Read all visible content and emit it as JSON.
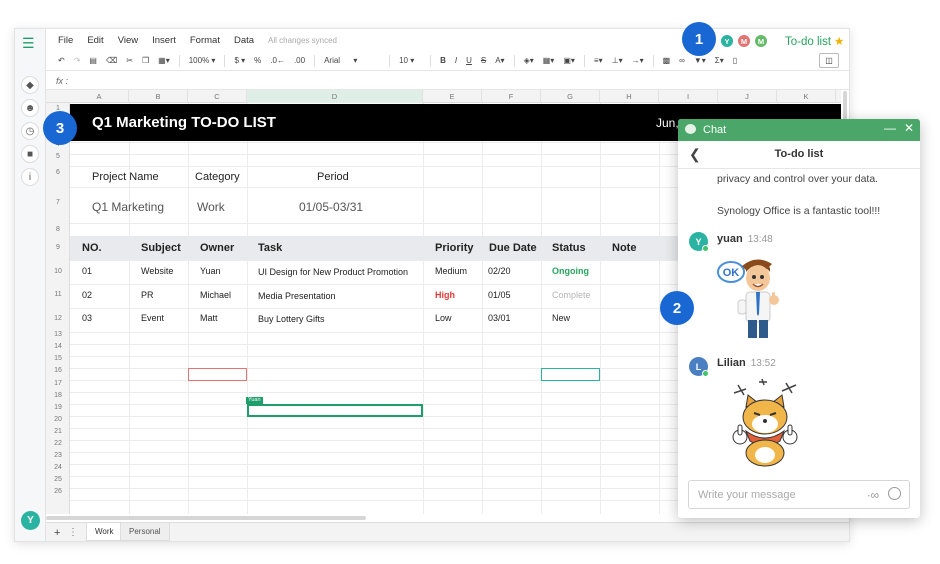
{
  "menu": [
    "File",
    "Edit",
    "View",
    "Insert",
    "Format",
    "Data"
  ],
  "sync_status": "All changes synced",
  "collaborators": [
    {
      "initial": "Y",
      "color": "#2bb3a1"
    },
    {
      "initial": "M",
      "color": "#e57373"
    },
    {
      "initial": "M",
      "color": "#66bb6a"
    }
  ],
  "doc_title": "To-do list",
  "toolbar": {
    "zoom": "100%",
    "currency": "$",
    "percent": "%",
    "font": "Arial",
    "size": "10"
  },
  "formula_label": "fx",
  "columns": [
    "A",
    "B",
    "C",
    "D",
    "E",
    "F",
    "G",
    "H",
    "I",
    "J",
    "K"
  ],
  "rows": [
    "1",
    "2",
    "3",
    "4",
    "5",
    "6",
    "7",
    "8",
    "9",
    "10",
    "11",
    "12",
    "13",
    "14",
    "15",
    "16",
    "17",
    "18",
    "19",
    "20",
    "21",
    "22",
    "23",
    "24",
    "25",
    "26"
  ],
  "sheet": {
    "title": "Q1 Marketing TO-DO LIST",
    "date": "Jun,",
    "project_label": "Project Name",
    "category_label": "Category",
    "period_label": "Period",
    "project_value": "Q1 Marketing",
    "category_value": "Work",
    "period_value": "01/05-03/31",
    "headers": [
      "NO.",
      "Subject",
      "Owner",
      "Task",
      "Priority",
      "Due Date",
      "Status",
      "Note"
    ],
    "tasks": [
      {
        "no": "01",
        "subject": "Website",
        "owner": "Yuan",
        "task": "UI Design for New Product Promotion",
        "priority": "Medium",
        "due": "02/20",
        "status": "Ongoing"
      },
      {
        "no": "02",
        "subject": "PR",
        "owner": "Michael",
        "task": "Media Presentation",
        "priority": "High",
        "due": "01/05",
        "status": "Complete"
      },
      {
        "no": "03",
        "subject": "Event",
        "owner": "Matt",
        "task": "Buy Lottery Gifts",
        "priority": "Low",
        "due": "03/01",
        "status": "New"
      }
    ],
    "cursor_label": "Yuan"
  },
  "rail_avatar": "Y",
  "sheet_tabs": [
    "Work",
    "Personal"
  ],
  "chat": {
    "window_title": "Chat",
    "room": "To-do list",
    "earlier_lines": [
      "privacy and control over your data.",
      "Synology Office is a fantastic tool!!!"
    ],
    "messages": [
      {
        "initial": "Y",
        "name": "yuan",
        "time": "13:48",
        "color": "#2bb3a1",
        "sticker_text": "OK"
      },
      {
        "initial": "L",
        "name": "Lilian",
        "time": "13:52",
        "color": "#4a7fc1"
      }
    ],
    "input_placeholder": "Write your message"
  },
  "badges": [
    "1",
    "2",
    "3"
  ]
}
